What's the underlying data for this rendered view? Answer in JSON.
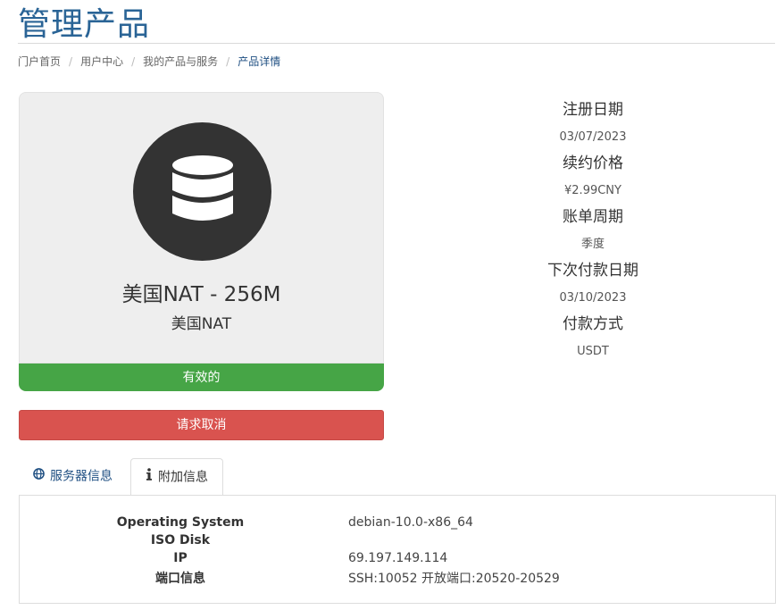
{
  "page_title": "管理产品",
  "breadcrumb": [
    "门户首页",
    "用户中心",
    "我的产品与服务",
    "产品详情"
  ],
  "product": {
    "icon": "database-icon",
    "name": "美国NAT - 256M",
    "group": "美国NAT",
    "status": "有效的",
    "cancel_label": "请求取消"
  },
  "info": {
    "reg_date_label": "注册日期",
    "reg_date": "03/07/2023",
    "renew_price_label": "续约价格",
    "renew_price": "¥2.99CNY",
    "billing_cycle_label": "账单周期",
    "billing_cycle": "季度",
    "next_due_label": "下次付款日期",
    "next_due": "03/10/2023",
    "payment_method_label": "付款方式",
    "payment_method": "USDT"
  },
  "tabs": [
    {
      "label": "服务器信息",
      "icon": "globe-icon",
      "active": false
    },
    {
      "label": "附加信息",
      "icon": "info-icon",
      "active": true
    }
  ],
  "details": [
    {
      "key": "Operating System",
      "value": "debian-10.0-x86_64"
    },
    {
      "key": "ISO Disk",
      "value": ""
    },
    {
      "key": "IP",
      "value": "69.197.149.114"
    },
    {
      "key": "端口信息",
      "value": "SSH:10052 开放端口:20520-20529"
    }
  ],
  "colors": {
    "title": "#2a6496",
    "status_green": "#46a546",
    "cancel_red": "#d9534f",
    "card_bg": "#eeeeee"
  }
}
